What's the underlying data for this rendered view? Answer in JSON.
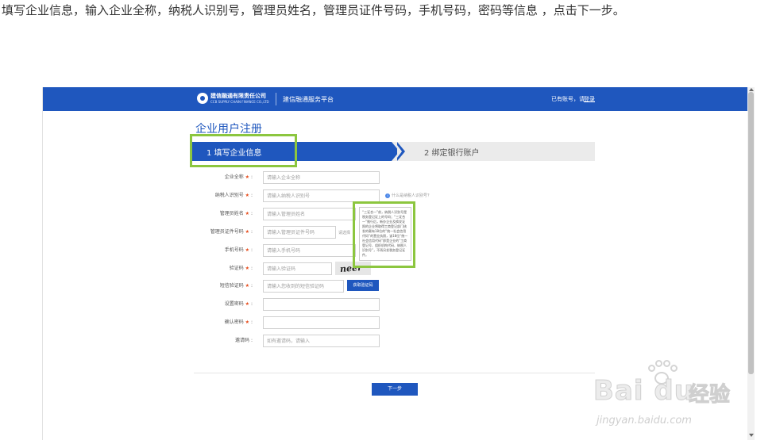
{
  "instruction": "填写企业信息，输入企业全称，纳税人识别号，管理员姓名，管理员证件号码，手机号码，密码等信息 ，点击下一步。",
  "header": {
    "logo_name": "建信融通有限责任公司",
    "logo_sub": "CCB SUPPLY CHAIN FINANCE CO.,LTD",
    "platform": "建信融通服务平台",
    "account_prompt": "已有账号，请",
    "login_label": "登录"
  },
  "page_title": "企业用户注册",
  "steps": [
    {
      "label": "1 填写企业信息"
    },
    {
      "label": "2 绑定银行账户"
    }
  ],
  "form": {
    "required_mark": "★",
    "fields": [
      {
        "label": "企业全称",
        "placeholder": "请输入企业全称"
      },
      {
        "label": "纳税人识别号",
        "placeholder": "请输入纳税人识别号"
      },
      {
        "label": "管理员姓名",
        "placeholder": "请输入管理员姓名"
      },
      {
        "label": "管理员证件号码",
        "placeholder": "请输入管理员证件号码"
      },
      {
        "label": "手机号码",
        "placeholder": "请输入手机号码"
      },
      {
        "label": "验证码",
        "placeholder": "请输入验证码"
      },
      {
        "label": "短信验证码",
        "placeholder": "请输入您收到的短信验证码"
      },
      {
        "label": "设置密码",
        "placeholder": ""
      },
      {
        "label": "确认密码",
        "placeholder": ""
      },
      {
        "label": "邀请码",
        "placeholder": "如有邀请码，请输入"
      }
    ],
    "help_link": "什么是纳税人识别号？",
    "upload_link": "请选择",
    "captcha_text": "neer",
    "sms_button": "获取验证码",
    "next_button": "下一步"
  },
  "tooltip": "“三证合一”前，纳税人识别号是税务登记证上的号码；“三证合一”推行后，新办企业及换发证照的企业将取得工商登记部门核发的载有18位的“统一社会信用代码”的营业执照，该18位“统一社会信用代码”即是企业的“工商登记号、组织机构代码、纳税人识别号”，不再另发税务登记证件。",
  "watermark": {
    "logo": "Bai du",
    "cn": "经验",
    "url": "jingyan.baidu.com"
  },
  "colors": {
    "brand_blue": "#1f57be",
    "highlight_green": "#8cc63f",
    "required_orange": "#e64a19"
  }
}
